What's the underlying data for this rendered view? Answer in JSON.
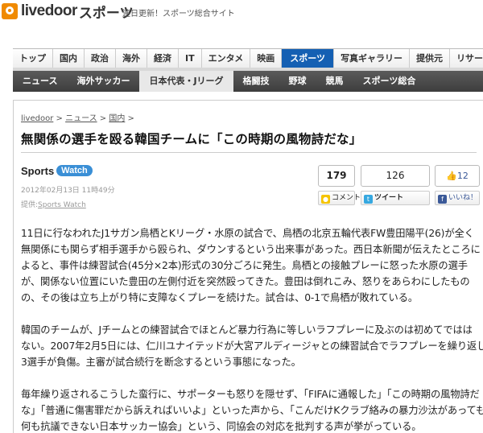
{
  "header": {
    "logo_text": "livedoor",
    "logo_sub": "スポーツ",
    "tagline": "連日更新！スポーツ総合サイト"
  },
  "nav": {
    "items": [
      "トップ",
      "国内",
      "政治",
      "海外",
      "経済",
      "IT",
      "エンタメ",
      "映画",
      "スポーツ",
      "写真ギャラリー",
      "提供元",
      "リサーチ"
    ],
    "active_index": 8
  },
  "subnav": {
    "items": [
      "ニュース",
      "海外サッカー",
      "日本代表・Jリーグ",
      "格闘技",
      "野球",
      "競馬",
      "スポーツ総合"
    ],
    "active_index": 2
  },
  "breadcrumb": {
    "items": [
      "livedoor",
      "ニュース",
      "国内"
    ],
    "separator": ">"
  },
  "article": {
    "title": "無関係の選手を殴る韓国チームに「この時期の風物詩だな」",
    "source_sports": "Sports",
    "source_watch": "Watch",
    "date": "2012年02月13日 11時49分",
    "provider_label": "提供:",
    "provider_name": "Sports Watch",
    "paragraphs": [
      [
        "11日に行なわれたJ1サガン鳥栖とKリーグ・水原の試合で、鳥栖の北京五輪代表FW豊田陽平(26)が全く",
        "無関係にも関らず相手選手から殴られ、ダウンするという出来事があった。西日本新聞が伝えたところに",
        "よると、事件は練習試合(45分×2本)形式の30分ごろに発生。鳥栖との接触プレーに怒った水原の選手",
        "が、関係ない位置にいた豊田の左側付近を突然殴ってきた。豊田は倒れこみ、怒りをあらわにしたもの",
        "の、その後は立ち上がり特に支障なくプレーを続けた。試合は、0-1で鳥栖が敗れている。"
      ],
      [
        "韓国のチームが、Jチームとの練習試合でほとんど暴力行為に等しいラフプレーに及ぶのは初めてではは",
        "ない。2007年2月5日には、仁川ユナイテッドが大宮アルディージャとの練習試合でラフプレーを繰り返し、",
        "3選手が負傷。主審が試合続行を断念するという事態になった。"
      ],
      [
        "毎年繰り返されるこうした蛮行に、サポーターも怒りを隠せず、「FIFAに通報した」「この時期の風物詩だ",
        "な」「普通に傷害罪だから訴えればいいよ」といった声から、「こんだけKクラブ絡みの暴力沙汰があっても",
        "何も抗議できない日本サッカー協会」という、同協会の対応を批判する声が挙がっている。"
      ]
    ]
  },
  "share": {
    "comment_count": "179",
    "tweet_count": "126",
    "like_count": "12",
    "comment_label": "コメント",
    "tweet_label": "ツイート",
    "like_label": "いいね！"
  },
  "colors": {
    "nav_active": "#1560b3",
    "subnav_bg": "#4a4a4a",
    "logo_orange": "#f08a00",
    "watch_badge": "#3a8fd6"
  }
}
